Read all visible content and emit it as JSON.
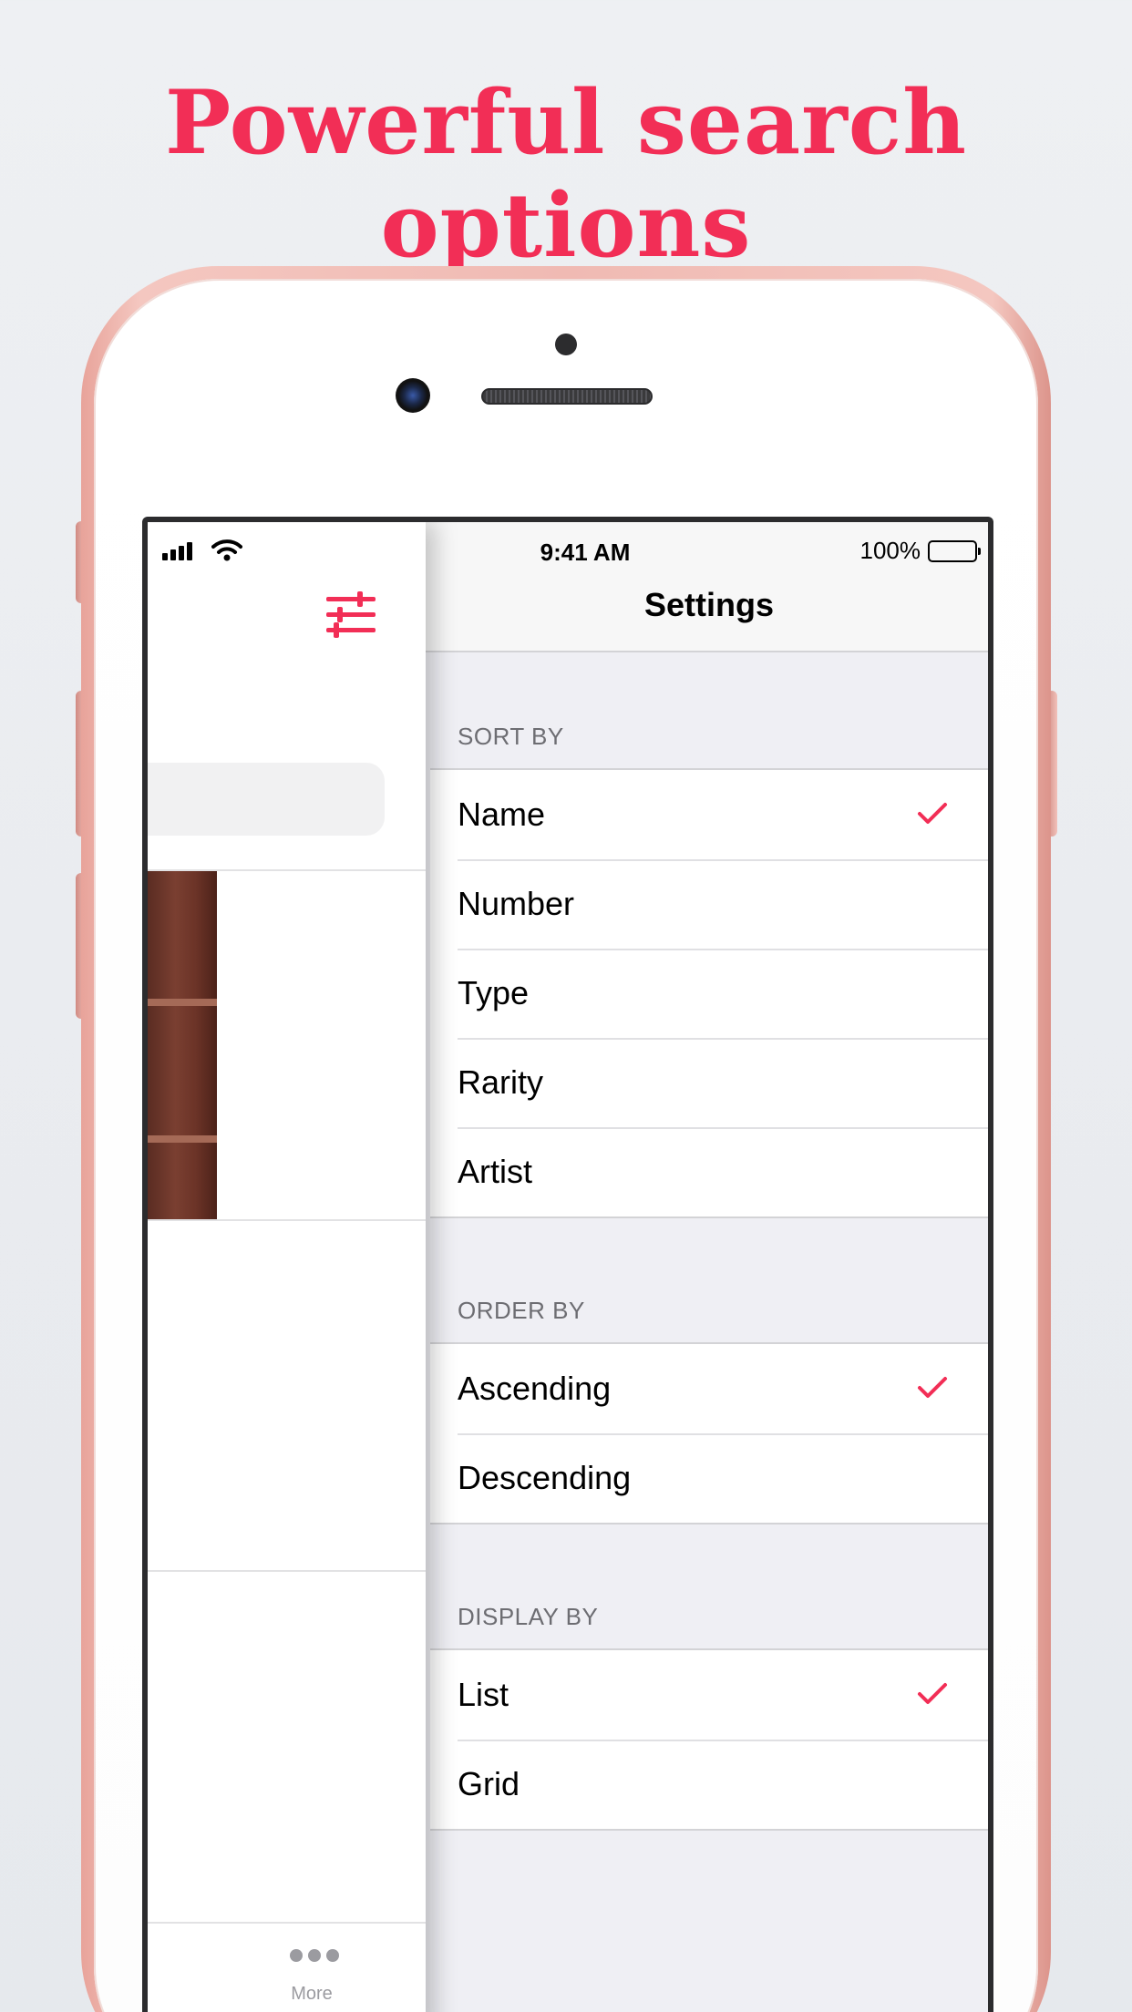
{
  "headline": "Powerful search options",
  "status_bar": {
    "time": "9:41 AM",
    "battery": "100%"
  },
  "nav": {
    "title": "Settings"
  },
  "sections": {
    "sort_by": {
      "header": "SORT BY",
      "options": [
        "Name",
        "Number",
        "Type",
        "Rarity",
        "Artist"
      ],
      "selected": "Name"
    },
    "order_by": {
      "header": "ORDER BY",
      "options": [
        "Ascending",
        "Descending"
      ],
      "selected": "Ascending"
    },
    "display_by": {
      "header": "DISPLAY BY",
      "options": [
        "List",
        "Grid"
      ],
      "selected": "List"
    }
  },
  "drawer": {
    "tab_more_label": "More",
    "icons": [
      "signal-icon",
      "wifi-icon",
      "filter-sliders-icon",
      "more-icon"
    ]
  },
  "colors": {
    "accent": "#f22e56",
    "phone_body": "#f0bab3",
    "grouped_background": "#efeff4"
  }
}
